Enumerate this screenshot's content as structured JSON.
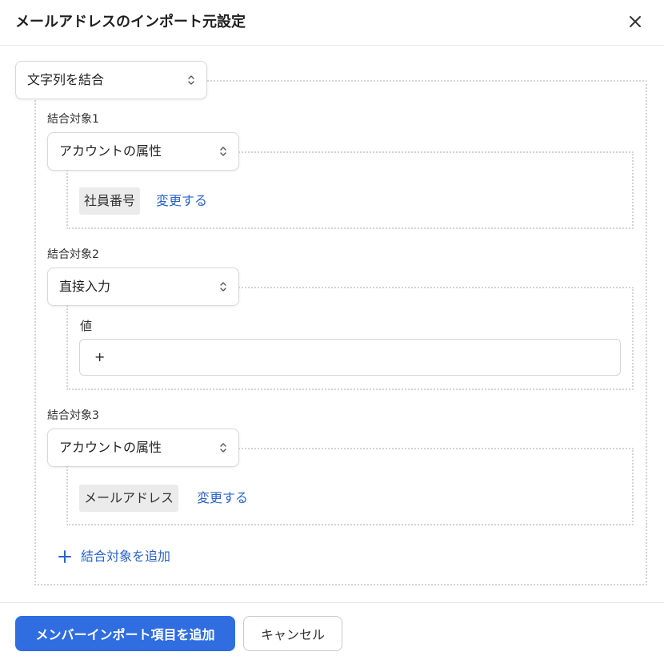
{
  "dialog": {
    "title": "メールアドレスのインポート元設定",
    "close_icon": "close-icon"
  },
  "method_select": {
    "value": "文字列を結合"
  },
  "targets": [
    {
      "label": "結合対象1",
      "source_select": "アカウントの属性",
      "attribute_chip": "社員番号",
      "change_link": "変更する"
    },
    {
      "label": "結合対象2",
      "source_select": "直接入力",
      "value_label": "値",
      "value_input": "+"
    },
    {
      "label": "結合対象3",
      "source_select": "アカウントの属性",
      "attribute_chip": "メールアドレス",
      "change_link": "変更する"
    }
  ],
  "add_target_link": "結合対象を追加",
  "footer": {
    "primary_button": "メンバーインポート項目を追加",
    "cancel_button": "キャンセル"
  },
  "colors": {
    "primary": "#2f6de1",
    "link": "#2a63c9",
    "chip_bg": "#ebebeb"
  }
}
